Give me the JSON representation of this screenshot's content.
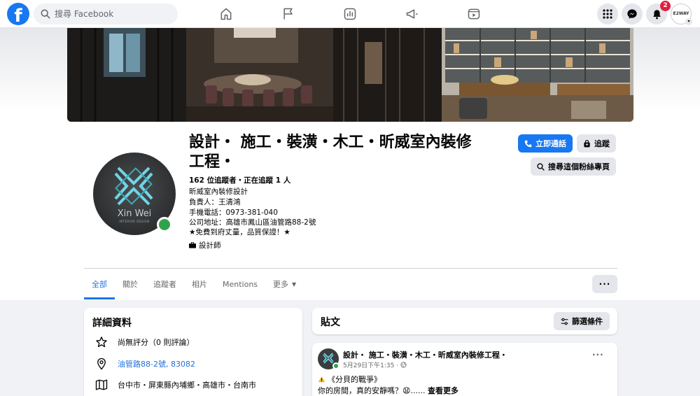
{
  "topnav": {
    "logo": "f",
    "search_placeholder": "搜尋 Facebook",
    "notification_count": "2",
    "profile_label": "E2WAY"
  },
  "page": {
    "name": "設計・ 施工・裝潢・木工・昕威室內裝修工程・",
    "followers": "162 位追蹤者・正在追蹤 1 人",
    "intro": [
      "昕威室內裝修設計",
      "負責人：王清鴻",
      "手機電話：0973-381-040",
      "公司地址：高雄市鳳山區油管路88-2號",
      "★免費到府丈量，品質保證！★"
    ],
    "category": "設計師",
    "avatar_brand": "Xin Wei",
    "avatar_sub": "INTERIOR DESIGN"
  },
  "actions": {
    "call": "立即通話",
    "follow": "追蹤",
    "search_page": "搜尋這個粉絲專頁"
  },
  "tabs": [
    "全部",
    "關於",
    "追蹤者",
    "相片",
    "Mentions",
    "更多"
  ],
  "details": {
    "title": "詳細資料",
    "rating": "尚無評分（0 則評論）",
    "address": "油管路88-2號, 83082",
    "service_area": "台中市・屏東縣內埔鄉・高雄市・台南市"
  },
  "posts": {
    "title": "貼文",
    "filter": "篩選條件",
    "post": {
      "author": "設計・ 施工・裝潢・木工・昕威室內裝修工程・",
      "time": "5月29日下午1:35 ·",
      "line1": "《分貝的戰爭》",
      "line2": "你的房間，真的安靜嗎？😧...... ",
      "see_more": "查看更多"
    }
  },
  "colors": {
    "brand": "#1877f2",
    "online": "#31a24c",
    "badge": "#e41e3f"
  }
}
